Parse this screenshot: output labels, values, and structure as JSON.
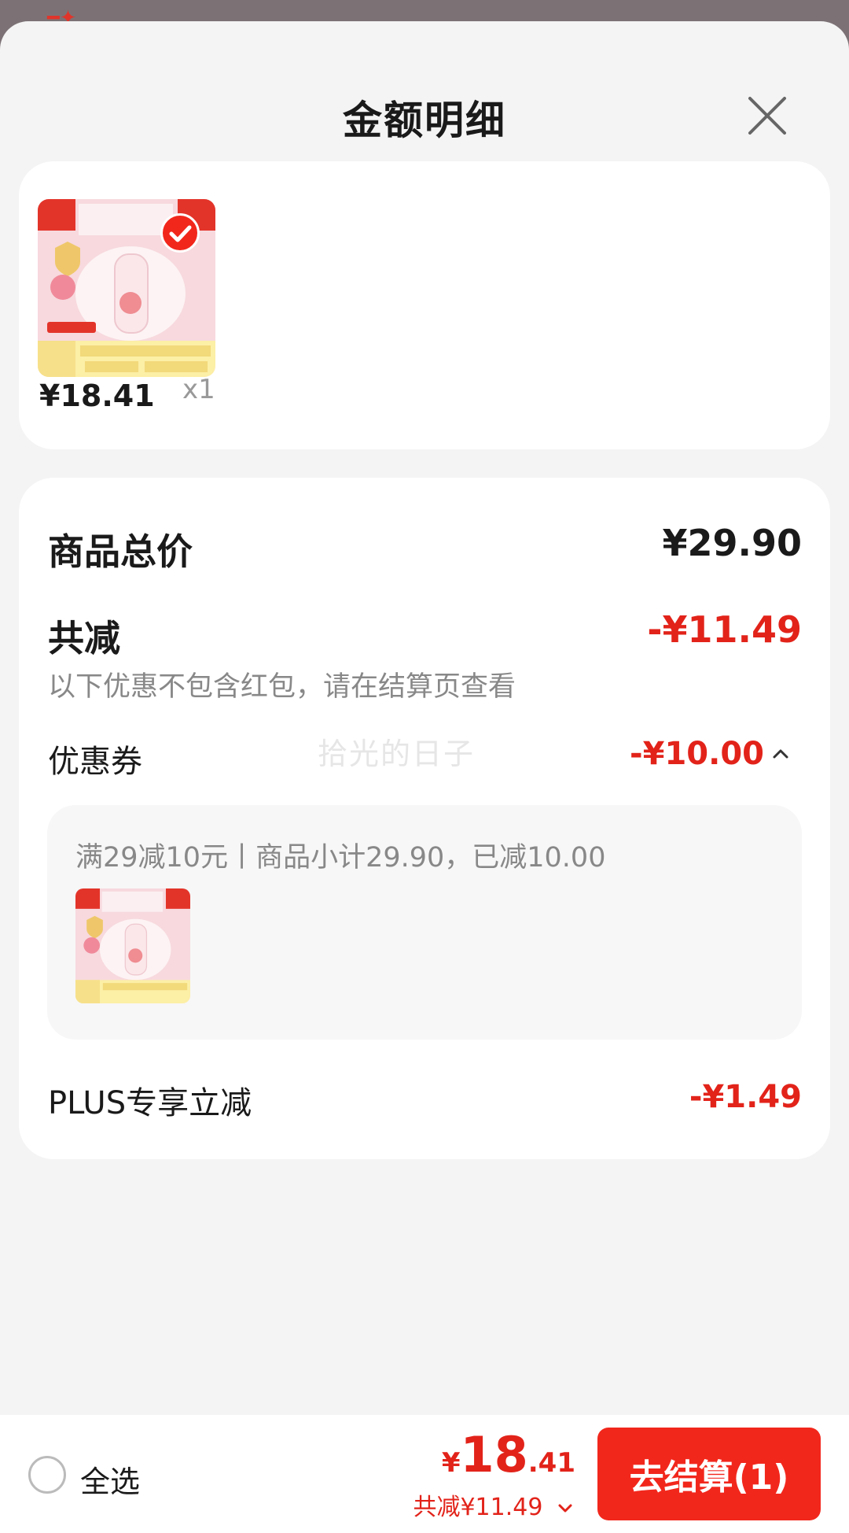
{
  "header": {
    "title": "金额明细"
  },
  "product": {
    "price": "¥18.41",
    "qty": "x1"
  },
  "detail": {
    "subtotal_label": "商品总价",
    "subtotal_value": "¥29.90",
    "discount_label": "共减",
    "discount_value": "-¥11.49",
    "discount_note": "以下优惠不包含红包，请在结算页查看",
    "coupon_label": "优惠券",
    "coupon_value": "-¥10.00",
    "coupon_desc": "满29减10元丨商品小计29.90，已减10.00",
    "plus_label": "PLUS专享立减",
    "plus_value": "-¥1.49"
  },
  "watermark": "拾光的日子",
  "bottom": {
    "select_all": "全选",
    "currency": "¥",
    "price_int": "18",
    "price_dec": ".41",
    "total_discount": "共减¥11.49",
    "checkout_label": "去结算(1)"
  },
  "colors": {
    "accent": "#e2231a",
    "button": "#f2271c"
  },
  "icons": [
    "close-icon",
    "check-icon",
    "chevron-up-icon",
    "chevron-down-icon"
  ]
}
